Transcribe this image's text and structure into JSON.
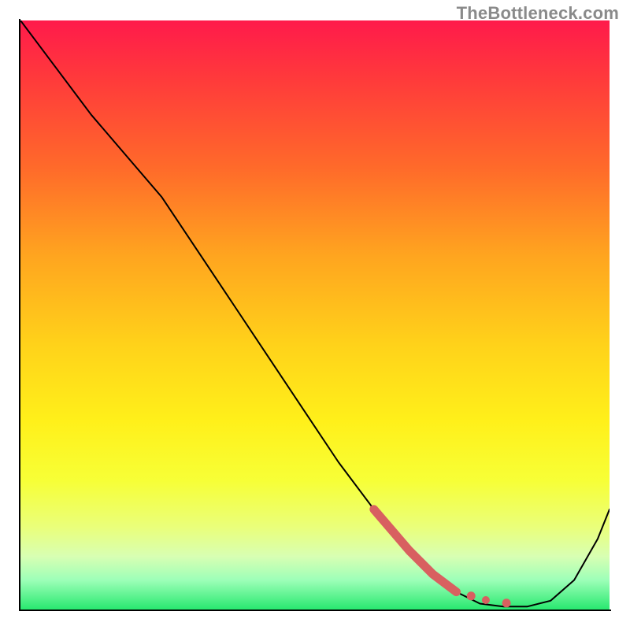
{
  "watermark": "TheBottleneck.com",
  "colors": {
    "curve": "#000000",
    "highlight": "#d86060",
    "gradient_top": "#ff1a4b",
    "gradient_bottom": "#28e86f"
  },
  "chart_data": {
    "type": "line",
    "title": "",
    "xlabel": "",
    "ylabel": "",
    "xlim": [
      0,
      100
    ],
    "ylim": [
      0,
      100
    ],
    "series": [
      {
        "name": "bottleneck-curve",
        "x": [
          0,
          6,
          12,
          18,
          24,
          30,
          36,
          42,
          48,
          54,
          60,
          66,
          70,
          74,
          78,
          82,
          86,
          90,
          94,
          98,
          100
        ],
        "y": [
          100,
          92,
          84,
          77,
          70,
          61,
          52,
          43,
          34,
          25,
          17,
          10,
          6,
          3,
          1,
          0.5,
          0.5,
          1.5,
          5,
          12,
          17
        ]
      }
    ],
    "highlight": {
      "segment": {
        "x": [
          60,
          66,
          70,
          74
        ],
        "y": [
          17,
          10,
          6,
          3
        ]
      },
      "dots": {
        "x": [
          76.5,
          79,
          82.5
        ],
        "y": [
          2.3,
          1.6,
          1.1
        ]
      }
    }
  }
}
